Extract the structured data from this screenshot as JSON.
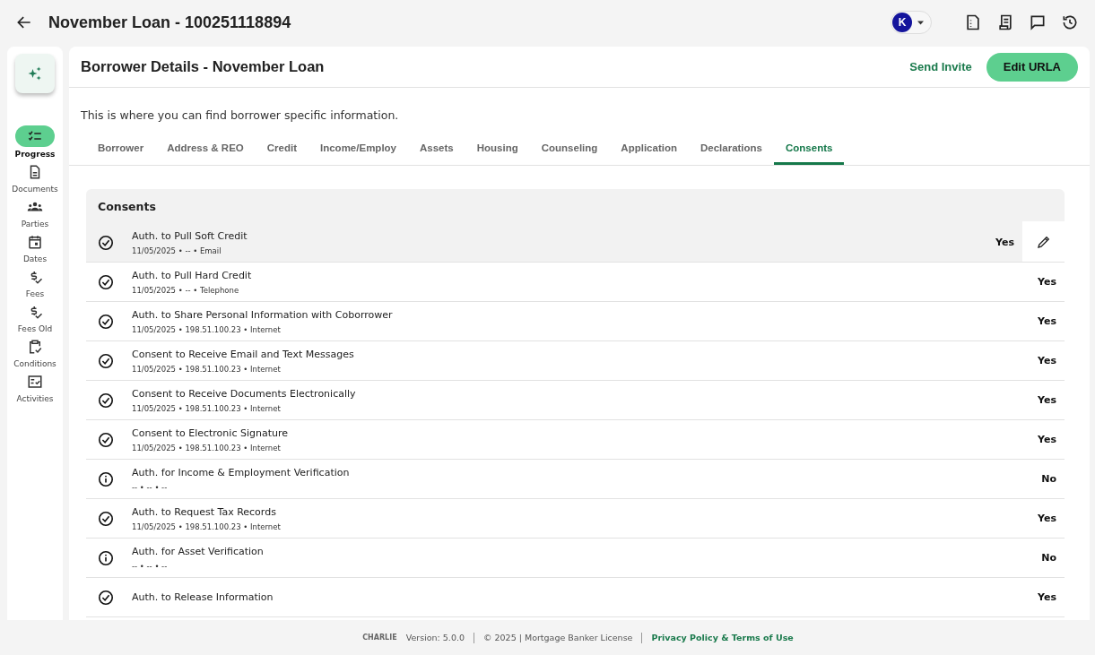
{
  "header": {
    "title": "November Loan - 100251118894",
    "avatar": "K"
  },
  "sidebar": {
    "items": [
      {
        "label": "Progress",
        "kind": "progress",
        "selected": true
      },
      {
        "label": "Documents",
        "kind": "document",
        "selected": false
      },
      {
        "label": "Parties",
        "kind": "people",
        "selected": false
      },
      {
        "label": "Dates",
        "kind": "calendar",
        "selected": false
      },
      {
        "label": "Fees",
        "kind": "fee",
        "selected": false
      },
      {
        "label": "Fees Old",
        "kind": "fee",
        "selected": false
      },
      {
        "label": "Conditions",
        "kind": "clipboard",
        "selected": false
      },
      {
        "label": "Activities",
        "kind": "checklist",
        "selected": false
      }
    ]
  },
  "page": {
    "title": "Borrower Details - November Loan",
    "actions": [
      {
        "label": "Send Invite",
        "kind": "text"
      },
      {
        "label": "Edit URLA",
        "kind": "filled"
      }
    ],
    "description": "This is where you can find borrower specific information.",
    "tabs": [
      {
        "label": "Borrower",
        "selected": false
      },
      {
        "label": "Address & REO",
        "selected": false
      },
      {
        "label": "Credit",
        "selected": false
      },
      {
        "label": "Income/Employ",
        "selected": false
      },
      {
        "label": "Assets",
        "selected": false
      },
      {
        "label": "Housing",
        "selected": false
      },
      {
        "label": "Counseling",
        "selected": false
      },
      {
        "label": "Application",
        "selected": false
      },
      {
        "label": "Declarations",
        "selected": false
      },
      {
        "label": "Consents",
        "selected": true
      }
    ]
  },
  "consents": {
    "title": "Consents",
    "rows": [
      {
        "kind": "check",
        "name": "Auth. to Pull Soft Credit",
        "details": "11/05/2025 • -- • Email",
        "value": "Yes",
        "hovered": true
      },
      {
        "kind": "check",
        "name": "Auth. to Pull Hard Credit",
        "details": "11/05/2025 • -- • Telephone",
        "value": "Yes",
        "hovered": false
      },
      {
        "kind": "check",
        "name": "Auth. to Share Personal Information with Coborrower",
        "details": "11/05/2025 • 198.51.100.23 • Internet",
        "value": "Yes",
        "hovered": false
      },
      {
        "kind": "check",
        "name": "Consent to Receive Email and Text Messages",
        "details": "11/05/2025 • 198.51.100.23 • Internet",
        "value": "Yes",
        "hovered": false
      },
      {
        "kind": "check",
        "name": "Consent to Receive Documents Electronically",
        "details": "11/05/2025 • 198.51.100.23 • Internet",
        "value": "Yes",
        "hovered": false
      },
      {
        "kind": "check",
        "name": "Consent to Electronic Signature",
        "details": "11/05/2025 • 198.51.100.23 • Internet",
        "value": "Yes",
        "hovered": false
      },
      {
        "kind": "info",
        "name": "Auth. for Income & Employment Verification",
        "details": "-- • -- • --",
        "value": "No",
        "hovered": false
      },
      {
        "kind": "check",
        "name": "Auth. to Request Tax Records",
        "details": "11/05/2025 • 198.51.100.23 • Internet",
        "value": "Yes",
        "hovered": false
      },
      {
        "kind": "info",
        "name": "Auth. for Asset Verification",
        "details": "-- • -- • --",
        "value": "No",
        "hovered": false
      },
      {
        "kind": "check",
        "name": "Auth. to Release Information",
        "value": "Yes",
        "hovered": false
      }
    ]
  },
  "footer": {
    "logo": "CHARLIE",
    "version": "Version: 5.0.0",
    "copyright": "© 2025 | Mortgage Banker License",
    "link": "Privacy Policy & Terms of Use"
  }
}
